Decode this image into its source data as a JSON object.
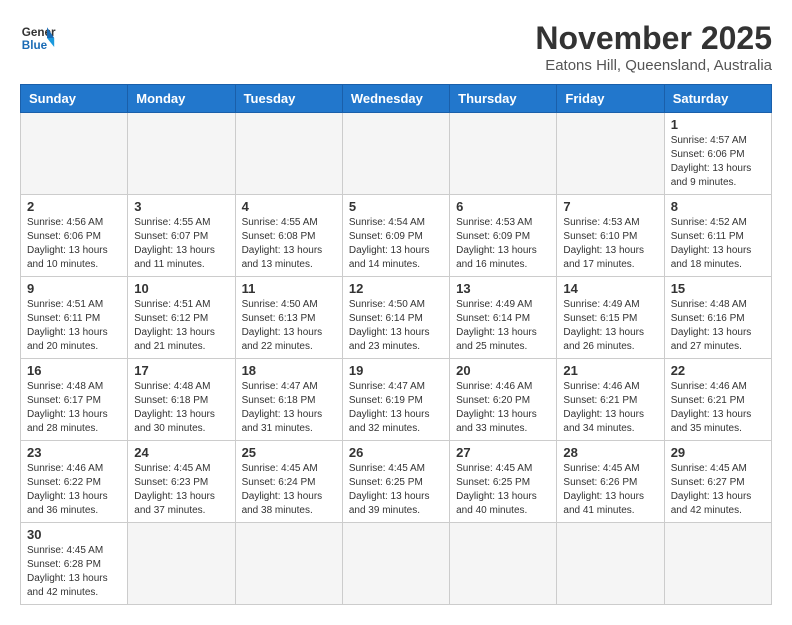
{
  "header": {
    "logo_general": "General",
    "logo_blue": "Blue",
    "month_title": "November 2025",
    "location": "Eatons Hill, Queensland, Australia"
  },
  "weekdays": [
    "Sunday",
    "Monday",
    "Tuesday",
    "Wednesday",
    "Thursday",
    "Friday",
    "Saturday"
  ],
  "weeks": [
    [
      {
        "day": "",
        "info": ""
      },
      {
        "day": "",
        "info": ""
      },
      {
        "day": "",
        "info": ""
      },
      {
        "day": "",
        "info": ""
      },
      {
        "day": "",
        "info": ""
      },
      {
        "day": "",
        "info": ""
      },
      {
        "day": "1",
        "info": "Sunrise: 4:57 AM\nSunset: 6:06 PM\nDaylight: 13 hours\nand 9 minutes."
      }
    ],
    [
      {
        "day": "2",
        "info": "Sunrise: 4:56 AM\nSunset: 6:06 PM\nDaylight: 13 hours\nand 10 minutes."
      },
      {
        "day": "3",
        "info": "Sunrise: 4:55 AM\nSunset: 6:07 PM\nDaylight: 13 hours\nand 11 minutes."
      },
      {
        "day": "4",
        "info": "Sunrise: 4:55 AM\nSunset: 6:08 PM\nDaylight: 13 hours\nand 13 minutes."
      },
      {
        "day": "5",
        "info": "Sunrise: 4:54 AM\nSunset: 6:09 PM\nDaylight: 13 hours\nand 14 minutes."
      },
      {
        "day": "6",
        "info": "Sunrise: 4:53 AM\nSunset: 6:09 PM\nDaylight: 13 hours\nand 16 minutes."
      },
      {
        "day": "7",
        "info": "Sunrise: 4:53 AM\nSunset: 6:10 PM\nDaylight: 13 hours\nand 17 minutes."
      },
      {
        "day": "8",
        "info": "Sunrise: 4:52 AM\nSunset: 6:11 PM\nDaylight: 13 hours\nand 18 minutes."
      }
    ],
    [
      {
        "day": "9",
        "info": "Sunrise: 4:51 AM\nSunset: 6:11 PM\nDaylight: 13 hours\nand 20 minutes."
      },
      {
        "day": "10",
        "info": "Sunrise: 4:51 AM\nSunset: 6:12 PM\nDaylight: 13 hours\nand 21 minutes."
      },
      {
        "day": "11",
        "info": "Sunrise: 4:50 AM\nSunset: 6:13 PM\nDaylight: 13 hours\nand 22 minutes."
      },
      {
        "day": "12",
        "info": "Sunrise: 4:50 AM\nSunset: 6:14 PM\nDaylight: 13 hours\nand 23 minutes."
      },
      {
        "day": "13",
        "info": "Sunrise: 4:49 AM\nSunset: 6:14 PM\nDaylight: 13 hours\nand 25 minutes."
      },
      {
        "day": "14",
        "info": "Sunrise: 4:49 AM\nSunset: 6:15 PM\nDaylight: 13 hours\nand 26 minutes."
      },
      {
        "day": "15",
        "info": "Sunrise: 4:48 AM\nSunset: 6:16 PM\nDaylight: 13 hours\nand 27 minutes."
      }
    ],
    [
      {
        "day": "16",
        "info": "Sunrise: 4:48 AM\nSunset: 6:17 PM\nDaylight: 13 hours\nand 28 minutes."
      },
      {
        "day": "17",
        "info": "Sunrise: 4:48 AM\nSunset: 6:18 PM\nDaylight: 13 hours\nand 30 minutes."
      },
      {
        "day": "18",
        "info": "Sunrise: 4:47 AM\nSunset: 6:18 PM\nDaylight: 13 hours\nand 31 minutes."
      },
      {
        "day": "19",
        "info": "Sunrise: 4:47 AM\nSunset: 6:19 PM\nDaylight: 13 hours\nand 32 minutes."
      },
      {
        "day": "20",
        "info": "Sunrise: 4:46 AM\nSunset: 6:20 PM\nDaylight: 13 hours\nand 33 minutes."
      },
      {
        "day": "21",
        "info": "Sunrise: 4:46 AM\nSunset: 6:21 PM\nDaylight: 13 hours\nand 34 minutes."
      },
      {
        "day": "22",
        "info": "Sunrise: 4:46 AM\nSunset: 6:21 PM\nDaylight: 13 hours\nand 35 minutes."
      }
    ],
    [
      {
        "day": "23",
        "info": "Sunrise: 4:46 AM\nSunset: 6:22 PM\nDaylight: 13 hours\nand 36 minutes."
      },
      {
        "day": "24",
        "info": "Sunrise: 4:45 AM\nSunset: 6:23 PM\nDaylight: 13 hours\nand 37 minutes."
      },
      {
        "day": "25",
        "info": "Sunrise: 4:45 AM\nSunset: 6:24 PM\nDaylight: 13 hours\nand 38 minutes."
      },
      {
        "day": "26",
        "info": "Sunrise: 4:45 AM\nSunset: 6:25 PM\nDaylight: 13 hours\nand 39 minutes."
      },
      {
        "day": "27",
        "info": "Sunrise: 4:45 AM\nSunset: 6:25 PM\nDaylight: 13 hours\nand 40 minutes."
      },
      {
        "day": "28",
        "info": "Sunrise: 4:45 AM\nSunset: 6:26 PM\nDaylight: 13 hours\nand 41 minutes."
      },
      {
        "day": "29",
        "info": "Sunrise: 4:45 AM\nSunset: 6:27 PM\nDaylight: 13 hours\nand 42 minutes."
      }
    ],
    [
      {
        "day": "30",
        "info": "Sunrise: 4:45 AM\nSunset: 6:28 PM\nDaylight: 13 hours\nand 42 minutes."
      },
      {
        "day": "",
        "info": ""
      },
      {
        "day": "",
        "info": ""
      },
      {
        "day": "",
        "info": ""
      },
      {
        "day": "",
        "info": ""
      },
      {
        "day": "",
        "info": ""
      },
      {
        "day": "",
        "info": ""
      }
    ]
  ]
}
